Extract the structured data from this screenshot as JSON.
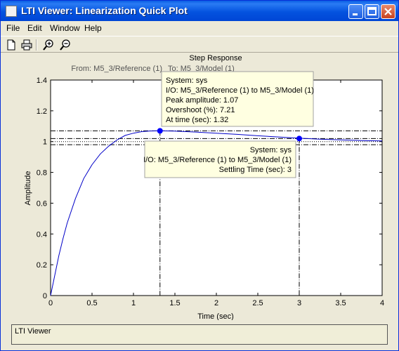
{
  "window": {
    "title": "LTI Viewer: Linearization Quick Plot"
  },
  "menu": [
    "File",
    "Edit",
    "Window",
    "Help"
  ],
  "toolbar": {
    "icons": [
      "new-file-icon",
      "print-icon",
      "zoom-in-icon",
      "zoom-out-icon"
    ]
  },
  "plot": {
    "title": "Step Response",
    "subtitle_from": "From: M5_3/Reference (1)",
    "subtitle_to": "To: M5_3/Model (1)",
    "xlabel": "Time (sec)",
    "ylabel": "Amplitude"
  },
  "chart_data": {
    "type": "line",
    "title": "Step Response",
    "xlabel": "Time (sec)",
    "ylabel": "Amplitude",
    "xlim": [
      0,
      4
    ],
    "ylim": [
      0,
      1.4
    ],
    "x_ticks": [
      "0",
      "0.5",
      "1",
      "1.5",
      "2",
      "2.5",
      "3",
      "3.5",
      "4"
    ],
    "y_ticks": [
      "0",
      "0.2",
      "0.4",
      "0.6",
      "0.8",
      "1",
      "1.2",
      "1.4"
    ],
    "series": [
      {
        "x": [
          0,
          0.05,
          0.1,
          0.15,
          0.2,
          0.3,
          0.4,
          0.5,
          0.6,
          0.7,
          0.8,
          0.9,
          1.0,
          1.1,
          1.2,
          1.32,
          1.5,
          1.75,
          2.0,
          2.25,
          2.5,
          2.75,
          3.0,
          3.25,
          3.5,
          3.75,
          4.0
        ],
        "y": [
          0,
          0.13,
          0.26,
          0.37,
          0.47,
          0.63,
          0.76,
          0.85,
          0.92,
          0.97,
          1.01,
          1.04,
          1.055,
          1.065,
          1.069,
          1.07,
          1.068,
          1.062,
          1.055,
          1.047,
          1.038,
          1.03,
          1.022,
          1.016,
          1.011,
          1.007,
          1.004
        ]
      }
    ],
    "reference_lines": {
      "steady_state": 1.0,
      "peak": 1.07,
      "settling_band": [
        0.98,
        1.02
      ]
    },
    "markers": [
      {
        "x": 1.32,
        "y": 1.07
      },
      {
        "x": 3.0,
        "y": 1.02
      }
    ]
  },
  "datatips": [
    {
      "lines": [
        "System: sys",
        "I/O: M5_3/Reference (1) to M5_3/Model (1)",
        "Peak amplitude: 1.07",
        "Overshoot (%): 7.21",
        "At time (sec): 1.32"
      ]
    },
    {
      "lines": [
        "System: sys",
        "I/O: M5_3/Reference (1) to M5_3/Model (1)",
        "Settling Time (sec): 3"
      ]
    }
  ],
  "status": {
    "text": "LTI Viewer"
  },
  "colors": {
    "curve": "#0000c8",
    "tip_bg": "#ffffe1",
    "marker": "#0000ff"
  }
}
